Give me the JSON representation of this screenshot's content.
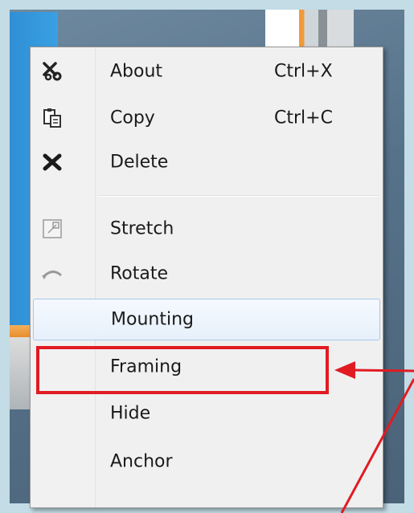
{
  "menu": {
    "items": [
      {
        "label": "About",
        "shortcut": "Ctrl+X",
        "icon": "scissors-icon"
      },
      {
        "label": "Copy",
        "shortcut": "Ctrl+C",
        "icon": "copy-icon"
      },
      {
        "label": "Delete",
        "shortcut": "",
        "icon": "delete-x-icon"
      },
      {
        "label": "Stretch",
        "shortcut": "",
        "icon": "stretch-icon"
      },
      {
        "label": "Rotate",
        "shortcut": "",
        "icon": "rotate-icon"
      },
      {
        "label": "Mounting",
        "shortcut": "",
        "icon": ""
      },
      {
        "label": "Framing",
        "shortcut": "",
        "icon": ""
      },
      {
        "label": "Hide",
        "shortcut": "",
        "icon": ""
      },
      {
        "label": "Anchor",
        "shortcut": "",
        "icon": ""
      }
    ],
    "hovered_item": "Mounting",
    "highlighted_item": "Framing"
  },
  "colors": {
    "annotation": "#e11b22",
    "menu_background": "#f0f0f0",
    "hover_border": "#a8c8ec"
  }
}
